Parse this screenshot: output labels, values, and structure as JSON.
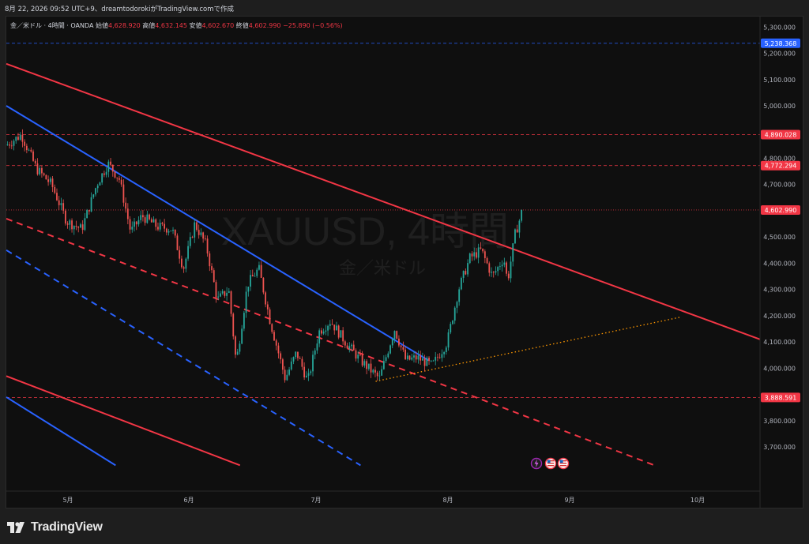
{
  "header": {
    "text": "8月 22, 2026 09:52 UTC+9、dreamtodorokiがTradingView.comで作成"
  },
  "legend": {
    "symbol_line": "金／米ドル · 4時間 · OANDA",
    "open_label": "始値",
    "open_value": "4,628.920",
    "high_label": "高値",
    "high_value": "4,632.145",
    "low_label": "安値",
    "low_value": "4,602.670",
    "close_label": "終値",
    "close_value": "4,602.990",
    "change": "−25.890 (−0.56%)"
  },
  "watermark": {
    "title": "XAUUSD, 4時間",
    "subtitle": "金／米ドル"
  },
  "footer": {
    "brand": "TradingView"
  },
  "colors": {
    "background": "#0f0f0f",
    "up": "#26a69a",
    "down": "#ef5350",
    "red_line": "#f23645",
    "blue_line": "#2962ff",
    "orange": "#ff9800",
    "price_label_red": "#f23645",
    "price_label_blue": "#2962ff"
  },
  "chart_data": {
    "type": "candlestick",
    "symbol": "XAUUSD",
    "timeframe": "4時間",
    "ylim": [
      3610,
      5340
    ],
    "x_tick_labels": [
      "5月",
      "6月",
      "7月",
      "8月",
      "9月",
      "10月"
    ],
    "y_tick_labels": [
      "5,300.000",
      "5,200.000",
      "5,100.000",
      "5,000.000",
      "4,800.000",
      "4,700.000",
      "4,500.000",
      "4,400.000",
      "4,300.000",
      "4,200.000",
      "4,100.000",
      "4,000.000",
      "3,800.000",
      "3,700.000"
    ],
    "y_tick_values": [
      5300,
      5200,
      5100,
      5000,
      4800,
      4700,
      4500,
      4400,
      4300,
      4200,
      4100,
      4000,
      3800,
      3700
    ],
    "price_levels": [
      {
        "value": 5238.368,
        "label": "5,238.368",
        "color": "blue",
        "style": "dashed"
      },
      {
        "value": 4890.028,
        "label": "4,890.028",
        "color": "red",
        "style": "dashed"
      },
      {
        "value": 4772.294,
        "label": "4,772.294",
        "color": "red",
        "style": "dashed"
      },
      {
        "value": 4602.99,
        "label": "4,602.990",
        "color": "red",
        "style": "dotted"
      },
      {
        "value": 3888.591,
        "label": "3,888.591",
        "color": "red",
        "style": "dashed"
      }
    ],
    "price_path": [
      [
        0,
        4850
      ],
      [
        0.02,
        4890
      ],
      [
        0.04,
        4760
      ],
      [
        0.06,
        4700
      ],
      [
        0.08,
        4560
      ],
      [
        0.1,
        4530
      ],
      [
        0.12,
        4700
      ],
      [
        0.135,
        4780
      ],
      [
        0.15,
        4720
      ],
      [
        0.165,
        4520
      ],
      [
        0.18,
        4580
      ],
      [
        0.2,
        4540
      ],
      [
        0.22,
        4530
      ],
      [
        0.235,
        4380
      ],
      [
        0.25,
        4550
      ],
      [
        0.265,
        4470
      ],
      [
        0.28,
        4260
      ],
      [
        0.295,
        4300
      ],
      [
        0.305,
        4020
      ],
      [
        0.32,
        4320
      ],
      [
        0.335,
        4380
      ],
      [
        0.35,
        4180
      ],
      [
        0.37,
        3960
      ],
      [
        0.385,
        4060
      ],
      [
        0.4,
        3950
      ],
      [
        0.415,
        4140
      ],
      [
        0.43,
        4180
      ],
      [
        0.45,
        4100
      ],
      [
        0.47,
        4030
      ],
      [
        0.495,
        3960
      ],
      [
        0.515,
        4150
      ],
      [
        0.53,
        4030
      ],
      [
        0.545,
        4040
      ],
      [
        0.565,
        4010
      ],
      [
        0.585,
        4100
      ],
      [
        0.6,
        4300
      ],
      [
        0.615,
        4420
      ],
      [
        0.63,
        4450
      ],
      [
        0.645,
        4350
      ],
      [
        0.66,
        4420
      ],
      [
        0.665,
        4330
      ],
      [
        0.675,
        4510
      ],
      [
        0.685,
        4602.99
      ]
    ],
    "trend_lines": [
      {
        "color": "red",
        "style": "solid",
        "points": [
          [
            0,
            5160
          ],
          [
            1,
            4110
          ]
        ]
      },
      {
        "color": "blue",
        "style": "solid",
        "points": [
          [
            0,
            5000
          ],
          [
            0.56,
            4030
          ]
        ]
      },
      {
        "color": "red",
        "style": "dashed",
        "points": [
          [
            0,
            4570
          ],
          [
            0.86,
            3630
          ]
        ]
      },
      {
        "color": "blue",
        "style": "dashed",
        "points": [
          [
            0,
            4450
          ],
          [
            0.47,
            3630
          ]
        ]
      },
      {
        "color": "red",
        "style": "solid",
        "points": [
          [
            0,
            3970
          ],
          [
            0.31,
            3630
          ]
        ]
      },
      {
        "color": "blue",
        "style": "solid",
        "points": [
          [
            0,
            3890
          ],
          [
            0.145,
            3630
          ]
        ]
      },
      {
        "color": "orange",
        "style": "dotted",
        "points": [
          [
            0.49,
            3950
          ],
          [
            0.895,
            4195
          ]
        ]
      }
    ],
    "event_icons": [
      "lightning-icon",
      "us-flag-icon",
      "us-flag-icon"
    ]
  }
}
